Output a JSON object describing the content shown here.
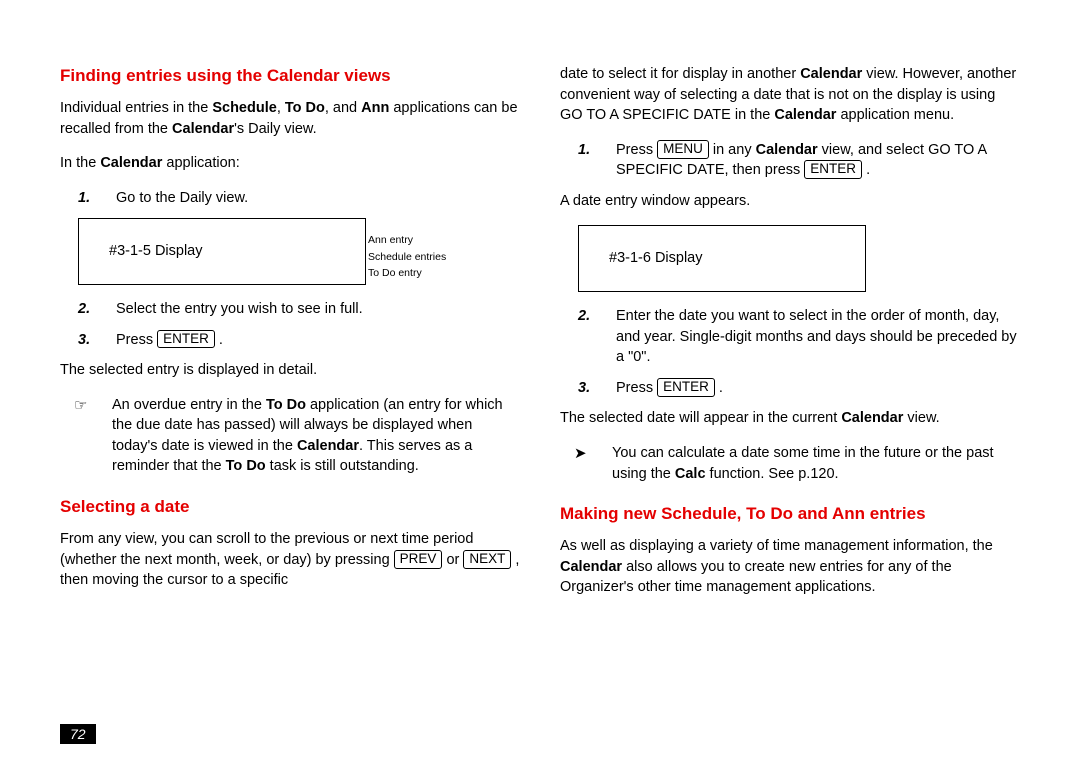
{
  "left": {
    "h1": "Finding entries using the Calendar views",
    "p1a": "Individual entries in the ",
    "p1b": "Schedule",
    "p1c": ", ",
    "p1d": "To Do",
    "p1e": ", and ",
    "p1f": "Ann",
    "p1g": " applications can be recalled from the ",
    "p1h": "Calendar",
    "p1i": "'s Daily view.",
    "p2a": "In the ",
    "p2b": "Calendar",
    "p2c": " application:",
    "s1n": "1.",
    "s1t": "Go to the Daily view.",
    "disp1": "#3-1-5 Display",
    "side1": "Ann entry",
    "side2": "Schedule entries",
    "side3": "To Do entry",
    "s2n": "2.",
    "s2t": "Select the entry you wish to see in full.",
    "s3n": "3.",
    "s3a": "Press ",
    "key_enter": "ENTER",
    "s3b": " .",
    "p3": "The selected entry is displayed in detail.",
    "b1icon": "☞",
    "b1a": "An overdue entry in the ",
    "b1b": "To Do",
    "b1c": " application (an entry for which the due date has passed) will always be displayed when today's date is viewed in the ",
    "b1d": "Calendar",
    "b1e": ". This serves as a reminder that the ",
    "b1f": "To Do",
    "b1g": " task is still outstanding.",
    "h2": "Selecting a date",
    "p4a": "From any view, you can scroll to the previous or next time period (whether the next month, week, or day) by pressing ",
    "key_prev": "PREV",
    "p4b": " or ",
    "key_next": "NEXT",
    "p4c": " , then moving the cursor to a specific"
  },
  "right": {
    "p1a": "date to select it for display in another ",
    "p1b": "Calendar",
    "p1c": " view. However, another convenient way of selecting a date that is not on the display is using GO TO A SPECIFIC DATE in the ",
    "p1d": "Calendar",
    "p1e": " application menu.",
    "s1n": "1.",
    "s1a": "Press ",
    "key_menu": "MENU",
    "s1b": " in any ",
    "s1c": "Calendar",
    "s1d": " view, and select GO TO A SPECIFIC DATE, then press ",
    "key_enter2": "ENTER",
    "s1e": " .",
    "p2": "A date entry window appears.",
    "disp2": "#3-1-6 Display",
    "s2n": "2.",
    "s2t": "Enter the date you want to select in the order of month, day, and year. Single-digit months and days should be preceded by a \"0\".",
    "s3n": "3.",
    "s3a": "Press ",
    "key_enter3": "ENTER",
    "s3b": " .",
    "p3a": "The selected date will appear in the current ",
    "p3b": "Calendar",
    "p3c": " view.",
    "b1icon": "➤",
    "b1a": "You can calculate a date some time in the future or the past using the ",
    "b1b": "Calc",
    "b1c": " function. See p.120.",
    "h1": "Making new Schedule, To Do and Ann entries",
    "p4a": "As well as displaying a variety of time management information, the ",
    "p4b": "Calendar",
    "p4c": " also allows you to create new entries for any of the Organizer's other time management applications."
  },
  "pagenum": "72"
}
